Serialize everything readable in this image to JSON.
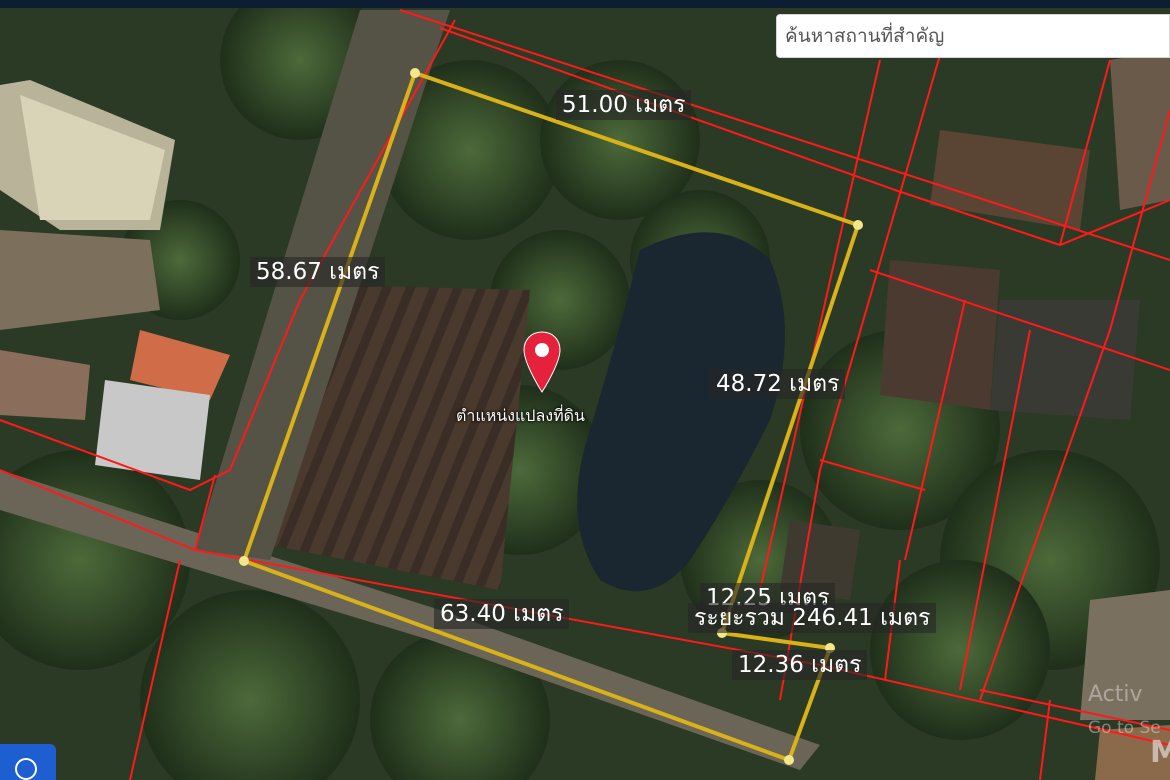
{
  "search": {
    "placeholder": "ค้นหาสถานที่สำคัญ"
  },
  "marker": {
    "label": "ตำแหน่งแปลงที่ดิน",
    "icon": "map-pin-icon",
    "color": "#e5213b"
  },
  "measurements": {
    "top": "51.00 เมตร",
    "left": "58.67 เมตร",
    "right": "48.72 เมตร",
    "bottom": "63.40 เมตร",
    "short_top": "12.25 เมตร",
    "short_bottom": "12.36 เมตร",
    "total": "ระยะรวม 246.41 เมตร"
  },
  "colors": {
    "measure_line": "#d9b118",
    "parcel_line": "#ff1a1a",
    "vertex": "#f2e88a"
  },
  "watermark": {
    "line1": "Activ",
    "line2": "Go to Se",
    "logo": "M"
  },
  "controls": {
    "locate_icon": "locate-icon"
  }
}
